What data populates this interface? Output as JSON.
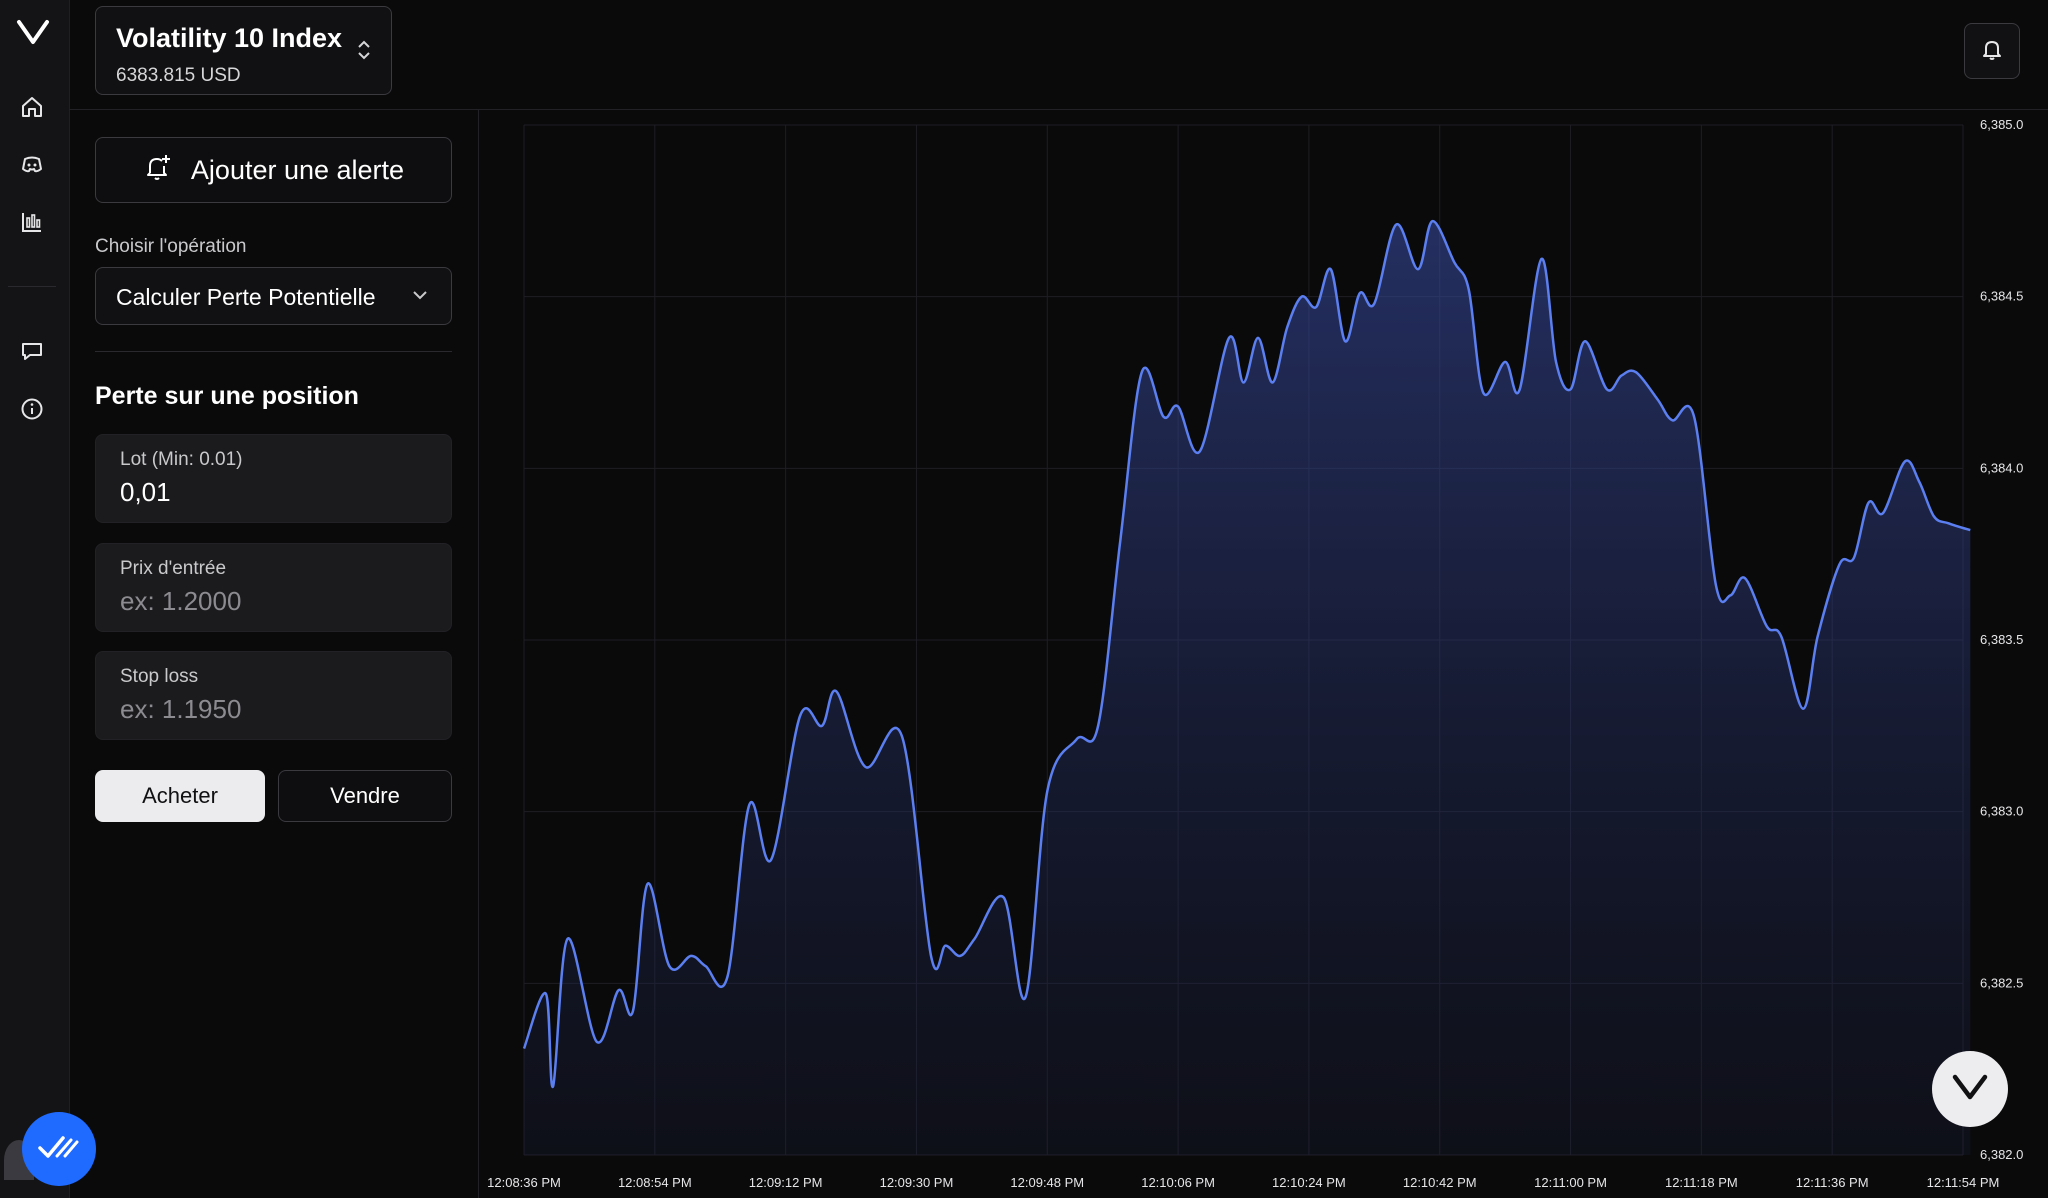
{
  "symbol": {
    "name": "Volatility 10 Index",
    "price": "6383.815 USD"
  },
  "panel": {
    "add_alert_label": "Ajouter une alerte",
    "operation_label": "Choisir l'opération",
    "operation_value": "Calculer Perte Potentielle",
    "section_title": "Perte sur une position",
    "fields": [
      {
        "label": "Lot (Min: 0.01)",
        "value": "0,01",
        "placeholder": ""
      },
      {
        "label": "Prix d'entrée",
        "value": "",
        "placeholder": "ex: 1.2000"
      },
      {
        "label": "Stop loss",
        "value": "",
        "placeholder": "ex: 1.1950"
      }
    ],
    "buy_label": "Acheter",
    "sell_label": "Vendre"
  },
  "colors": {
    "line": "#5b7ff0",
    "accent_badge": "#1f6bff",
    "background": "#0a0a0b"
  },
  "icons": [
    "logo-icon",
    "home-icon",
    "discord-icon",
    "chart-icon",
    "chat-icon",
    "info-icon",
    "bell-icon",
    "bell-plus-icon",
    "chevron-down-icon",
    "updown-icon",
    "check-icon"
  ],
  "chart_data": {
    "type": "area",
    "yticks": [
      "6,385.0",
      "6,384.5",
      "6,384.0",
      "6,383.5",
      "6,383.0",
      "6,382.5",
      "6,382.0"
    ],
    "ylim": [
      6382.0,
      6385.0
    ],
    "xticks": [
      "12:08:36 PM",
      "12:08:54 PM",
      "12:09:12 PM",
      "12:09:30 PM",
      "12:09:48 PM",
      "12:10:06 PM",
      "12:10:24 PM",
      "12:10:42 PM",
      "12:11:00 PM",
      "12:11:18 PM",
      "12:11:36 PM",
      "12:11:54 PM"
    ],
    "x": [
      "12:08:36",
      "12:08:39",
      "12:08:40",
      "12:08:42",
      "12:08:46",
      "12:08:49",
      "12:08:51",
      "12:08:53",
      "12:08:56",
      "12:08:59",
      "12:09:01",
      "12:09:04",
      "12:09:07",
      "12:09:10",
      "12:09:14",
      "12:09:17",
      "12:09:19",
      "12:09:23",
      "12:09:28",
      "12:09:32",
      "12:09:34",
      "12:09:36",
      "12:09:38",
      "12:09:42",
      "12:09:45",
      "12:09:48",
      "12:09:52",
      "12:09:55",
      "12:09:58",
      "12:10:01",
      "12:10:04",
      "12:10:06",
      "12:10:09",
      "12:10:13",
      "12:10:15",
      "12:10:17",
      "12:10:19",
      "12:10:21",
      "12:10:23",
      "12:10:25",
      "12:10:27",
      "12:10:29",
      "12:10:31",
      "12:10:33",
      "12:10:36",
      "12:10:39",
      "12:10:41",
      "12:10:44",
      "12:10:46",
      "12:10:48",
      "12:10:51",
      "12:10:53",
      "12:10:56",
      "12:10:58",
      "12:11:00",
      "12:11:02",
      "12:11:05",
      "12:11:07",
      "12:11:09",
      "12:11:12",
      "12:11:14",
      "12:11:17",
      "12:11:20",
      "12:11:22",
      "12:11:24",
      "12:11:27",
      "12:11:29",
      "12:11:32",
      "12:11:34",
      "12:11:37",
      "12:11:39",
      "12:11:41",
      "12:11:43",
      "12:11:46",
      "12:11:48",
      "12:11:50",
      "12:11:52",
      "12:11:55"
    ],
    "values": [
      6382.31,
      6382.47,
      6382.2,
      6382.63,
      6382.33,
      6382.48,
      6382.42,
      6382.79,
      6382.55,
      6382.58,
      6382.55,
      6382.52,
      6383.02,
      6382.86,
      6383.28,
      6383.25,
      6383.35,
      6383.13,
      6383.22,
      6382.58,
      6382.61,
      6382.58,
      6382.63,
      6382.75,
      6382.46,
      6383.06,
      6383.21,
      6383.25,
      6383.78,
      6384.28,
      6384.15,
      6384.18,
      6384.05,
      6384.38,
      6384.25,
      6384.38,
      6384.25,
      6384.41,
      6384.5,
      6384.47,
      6384.58,
      6384.37,
      6384.51,
      6384.48,
      6384.71,
      6384.58,
      6384.72,
      6384.6,
      6384.52,
      6384.22,
      6384.31,
      6384.23,
      6384.61,
      6384.31,
      6384.23,
      6384.37,
      6384.23,
      6384.27,
      6384.28,
      6384.2,
      6384.14,
      6384.15,
      6383.66,
      6383.63,
      6383.68,
      6383.54,
      6383.51,
      6383.3,
      6383.51,
      6383.72,
      6383.74,
      6383.9,
      6383.87,
      6384.02,
      6383.96,
      6383.86,
      6383.84,
      6383.82
    ],
    "grid": true,
    "line_color": "#5b7ff0"
  }
}
